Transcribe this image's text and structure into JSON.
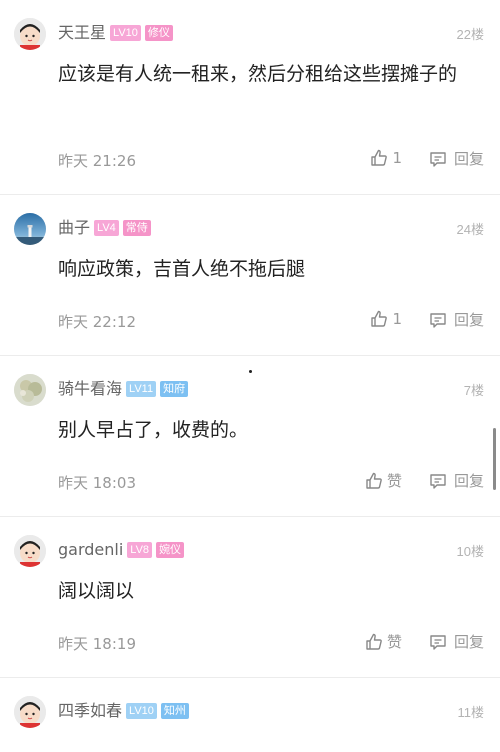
{
  "comments": [
    {
      "username": "天王星",
      "level": "LV10",
      "tag": "修仪",
      "floor": "22楼",
      "text": "应该是有人统一租来，然后分租给这些摆摊子的",
      "time": "昨天 21:26",
      "likes": "1",
      "reply": "回复"
    },
    {
      "username": "曲子",
      "level": "LV4",
      "tag": "常侍",
      "floor": "24楼",
      "text": "响应政策，吉首人绝不拖后腿",
      "time": "昨天 22:12",
      "likes": "1",
      "reply": "回复"
    },
    {
      "username": "骑牛看海",
      "level": "LV11",
      "tag": "知府",
      "floor": "7楼",
      "text": "别人早占了，收费的。",
      "time": "昨天 18:03",
      "likes": "赞",
      "reply": "回复"
    },
    {
      "username": "gardenli",
      "level": "LV8",
      "tag": "婉仪",
      "floor": "10楼",
      "text": "阔以阔以",
      "time": "昨天 18:19",
      "likes": "赞",
      "reply": "回复"
    },
    {
      "username": "四季如春",
      "level": "LV10",
      "tag": "知州",
      "floor": "11楼"
    }
  ],
  "colors": {
    "lv_pink": "#f7a6d6",
    "lv_blue": "#9fd1f5",
    "tag_pink": "#f594c8",
    "tag_blue": "#7dc0f2"
  }
}
